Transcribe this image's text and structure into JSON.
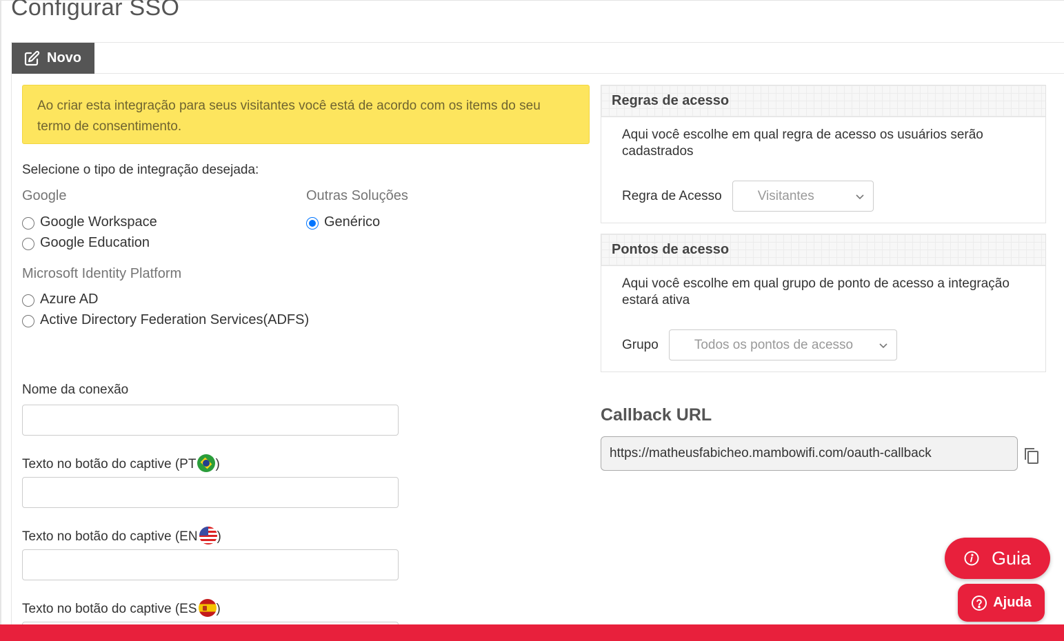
{
  "page": {
    "title": "Configurar SSO"
  },
  "tabs": {
    "new_label": "Novo"
  },
  "alert": {
    "text": "Ao criar esta integração para seus visitantes você está de acordo com os items do seu termo de consentimento."
  },
  "integration": {
    "prompt": "Selecione o tipo de integração desejada:",
    "groups": {
      "google": {
        "label": "Google",
        "options": [
          "Google Workspace",
          "Google Education"
        ]
      },
      "other": {
        "label": "Outras Soluções",
        "options": [
          "Genérico"
        ],
        "selected": "Genérico"
      },
      "microsoft": {
        "label": "Microsoft Identity Platform",
        "options": [
          "Azure AD",
          "Active Directory Federation Services(ADFS)"
        ]
      }
    }
  },
  "form": {
    "connection_name_label": "Nome da conexão",
    "captive_pt_label": "Texto no botão do captive (PT",
    "captive_en_label": "Texto no botão do captive (EN",
    "captive_es_label": "Texto no botão do captive (ES",
    "closing_paren": ")"
  },
  "access_rules": {
    "title": "Regras de acesso",
    "description": "Aqui você escolhe em qual regra de acesso os usuários serão cadastrados",
    "field_label": "Regra de Acesso",
    "selected_value": "Visitantes"
  },
  "access_points": {
    "title": "Pontos de acesso",
    "description": "Aqui você escolhe em qual grupo de ponto de acesso a integração estará ativa",
    "field_label": "Grupo",
    "selected_value": "Todos os pontos de acesso"
  },
  "callback": {
    "title": "Callback URL",
    "url": "https://matheusfabicheo.mambowifi.com/oauth-callback"
  },
  "floating": {
    "guide_label": "Guia",
    "help_label": "Ajuda"
  },
  "colors": {
    "accent": "#e8203c",
    "alert_bg": "#fde55e",
    "tab_bg": "#555555",
    "radio_checked": "#0075ff"
  }
}
